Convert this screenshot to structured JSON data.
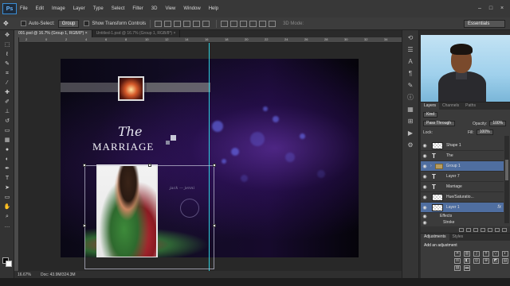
{
  "menubar": {
    "logo": "Ps",
    "items": [
      "File",
      "Edit",
      "Image",
      "Layer",
      "Type",
      "Select",
      "Filter",
      "3D",
      "View",
      "Window",
      "Help"
    ]
  },
  "options": {
    "auto_select_label": "Auto-Select:",
    "auto_select_value": "Group",
    "show_transform_label": "Show Transform Controls",
    "mode_3d_label": "3D Mode:",
    "workspace_value": "Essentials"
  },
  "tabs": [
    {
      "label": "001.psd @ 16.7% (Group 1, RGB/8*) ×",
      "active": true
    },
    {
      "label": "Untitled-1.psd @ 16.7% (Group 1, RGB/8*) ×",
      "active": false
    }
  ],
  "canvas": {
    "title_the": "The",
    "title_marriage": "MARRIAGE",
    "signature": "jack — jenni"
  },
  "status": {
    "zoom": "16.67%",
    "doc": "Doc: 43.9M/324.3M"
  },
  "layers_panel": {
    "tabs": [
      "Layers",
      "Channels",
      "Paths"
    ],
    "filter_label": "Kind",
    "blend_mode": "Pass Through",
    "opacity_label": "Opacity:",
    "opacity_value": "100%",
    "lock_label": "Lock:",
    "fill_label": "Fill:",
    "fill_value": "100%",
    "layers": [
      {
        "name": "Shape 1",
        "kind": "checker"
      },
      {
        "name": "The",
        "kind": "type"
      },
      {
        "name": "Group 1",
        "kind": "folder",
        "selected": true
      },
      {
        "name": "Layer 7",
        "kind": "type"
      },
      {
        "name": "Marriage",
        "kind": "type"
      },
      {
        "name": "Hue/Saturatio...",
        "kind": "checker"
      },
      {
        "name": "Layer 1",
        "kind": "checker",
        "fx": "fx"
      },
      {
        "name": "Effects",
        "kind": "effect"
      },
      {
        "name": "Stroke",
        "kind": "effect"
      }
    ]
  },
  "adjustments_panel": {
    "tabs": [
      "Adjustments",
      "Styles"
    ],
    "heading": "Add an adjustment"
  },
  "ruler_numbers": [
    "2",
    "0",
    "2",
    "4",
    "6",
    "8",
    "10",
    "12",
    "14",
    "16",
    "18",
    "20",
    "22",
    "24",
    "26",
    "28",
    "30",
    "32",
    "34"
  ]
}
